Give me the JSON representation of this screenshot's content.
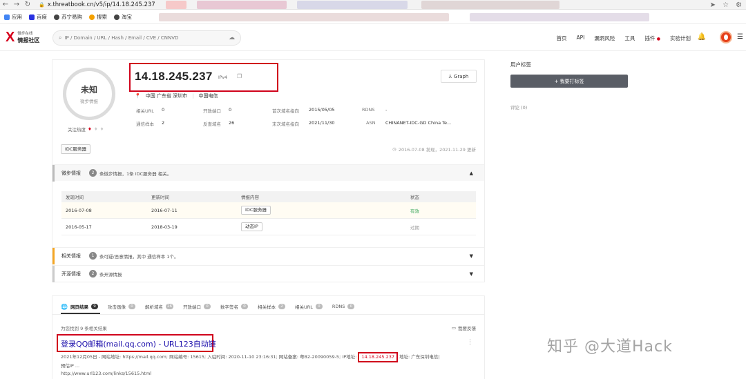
{
  "browser": {
    "url": "x.threatbook.cn/v5/ip/14.18.245.237",
    "bookmarks": [
      {
        "label": "应用",
        "color": "#4285f4"
      },
      {
        "label": "百度",
        "color": "#2932e1"
      },
      {
        "label": "苏宁易购",
        "color": "#333333"
      },
      {
        "label": "搜索",
        "color": "#f4a000"
      },
      {
        "label": "淘宝",
        "color": "#333333"
      }
    ]
  },
  "header": {
    "logo_x": "X",
    "logo_small": "微步在线",
    "logo_big": "情报社区",
    "search_placeholder": "IP / Domain / URL / Hash / Email / CVE / CNNVD",
    "nav": [
      "首页",
      "API",
      "漏洞风险",
      "工具",
      "插件",
      "实验计划"
    ]
  },
  "summary": {
    "verdict": "未知",
    "verdict_sub": "微步情报",
    "heat_label": "关注热度",
    "ip": "14.18.245.237",
    "ip_type": "IPv4",
    "graph_label": "Graph",
    "location": "中国 广东省 深圳市",
    "isp": "中国电信",
    "rows": [
      [
        {
          "k": "相关URL",
          "v": "0"
        },
        {
          "k": "开放端口",
          "v": "0"
        },
        {
          "k": "首次域名指向",
          "v": "2015/05/05"
        },
        {
          "k": "RDNS",
          "v": "-"
        }
      ],
      [
        {
          "k": "通信样本",
          "v": "2"
        },
        {
          "k": "反查域名",
          "v": "26"
        },
        {
          "k": "末次域名指向",
          "v": "2021/11/30"
        },
        {
          "k": "ASN",
          "v": "CHINANET-IDC-GD China Te..."
        }
      ]
    ],
    "tag": "IDC服务器",
    "update_info": "2016-07-08 发现，2021-11-29 更新"
  },
  "sections": {
    "micro": {
      "label": "微步情报",
      "count": "2",
      "text": "条微步情报，1条 IDC服务器 相关。"
    },
    "related": {
      "label": "相关情报",
      "count": "1",
      "text": "条可疑/恶意情报，其中 通信样本 1个。"
    },
    "open": {
      "label": "开源情报",
      "count": "2",
      "text": "条开源情报"
    }
  },
  "intel_table": {
    "headers": [
      "发现时间",
      "更新时间",
      "情报内容",
      "状态"
    ],
    "rows": [
      {
        "found": "2016-07-08",
        "updated": "2016-07-11",
        "content": "IDC服务器",
        "status": "有效"
      },
      {
        "found": "2016-05-17",
        "updated": "2018-03-19",
        "content": "动态IP",
        "status": "过期"
      }
    ]
  },
  "sidebar": {
    "title": "用户标签",
    "tag_button": "+ 我要打标签",
    "comments": "评论 (0)"
  },
  "results": {
    "tabs": [
      {
        "label": "网页结果",
        "count": "9"
      },
      {
        "label": "攻击画像",
        "count": "0"
      },
      {
        "label": "解析域名",
        "count": "26"
      },
      {
        "label": "开放端口",
        "count": "0"
      },
      {
        "label": "数字签名",
        "count": "0"
      },
      {
        "label": "相关样本",
        "count": "2"
      },
      {
        "label": "相关URL",
        "count": "0"
      },
      {
        "label": "RDNS",
        "count": "0"
      }
    ],
    "found_text": "为您找到 9 条相关结果",
    "feedback": "我要反馈",
    "title": "登录QQ邮箱(mail.qq.com) - URL123自动链",
    "snippet_pre": "2021年12月05日 - 网站地址: https://mail.qq.com; 网站编号: 15615; 入驻时间: 2020-11-10 23:16:31; 网站备案: 粤B2-20090059-5; IP地址: ",
    "snippet_ip": "14.18.245.237",
    "snippet_post": " 地址: 广东深圳电信|",
    "snippet_line2": "预估IP ...",
    "url": "http://www.url123.com/links/15615.html"
  },
  "watermark": "知乎 @大道Hack",
  "colors": {
    "brand": "#d6001c",
    "highlight_border": "#d0021b",
    "valid": "#3aa65a",
    "link": "#1a0dab",
    "warning_accent": "#f5a623"
  }
}
